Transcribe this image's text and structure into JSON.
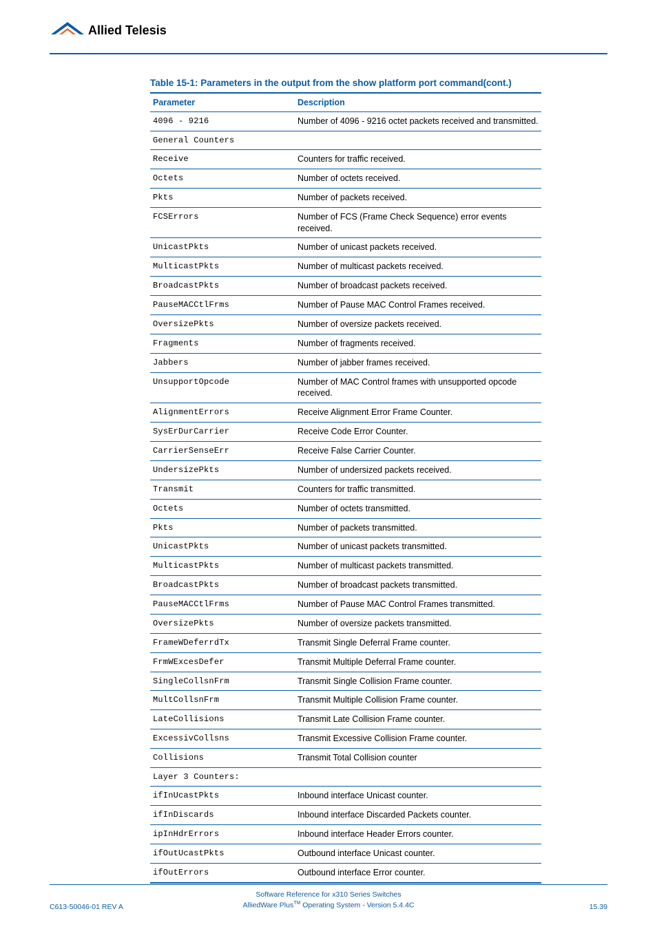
{
  "logo_text": "Allied Telesis",
  "table_caption": "Table 15-1: Parameters in the output from the show platform port command(cont.)",
  "headers": {
    "param": "Parameter",
    "desc": "Description"
  },
  "rows": [
    {
      "param": "4096 - 9216",
      "desc": "Number of 4096 - 9216 octet packets received and transmitted."
    },
    {
      "param": "General Counters",
      "desc": ""
    },
    {
      "param": "Receive",
      "desc": "Counters for traffic received."
    },
    {
      "param": "Octets",
      "desc": "Number of octets received."
    },
    {
      "param": "Pkts",
      "desc": "Number of packets received."
    },
    {
      "param": "FCSErrors",
      "desc": "Number of FCS (Frame Check Sequence) error events received."
    },
    {
      "param": "UnicastPkts",
      "desc": "Number of unicast packets received."
    },
    {
      "param": "MulticastPkts",
      "desc": "Number of multicast packets received."
    },
    {
      "param": "BroadcastPkts",
      "desc": "Number of broadcast packets received."
    },
    {
      "param": "PauseMACCtlFrms",
      "desc": "Number of Pause MAC Control Frames received."
    },
    {
      "param": "OversizePkts",
      "desc": "Number of oversize packets received."
    },
    {
      "param": "Fragments",
      "desc": "Number of fragments received."
    },
    {
      "param": "Jabbers",
      "desc": "Number of jabber frames received."
    },
    {
      "param": "UnsupportOpcode",
      "desc": "Number of MAC Control frames with unsupported opcode received."
    },
    {
      "param": "AlignmentErrors",
      "desc": "Receive Alignment Error Frame Counter."
    },
    {
      "param": "SysErDurCarrier",
      "desc": "Receive Code Error Counter."
    },
    {
      "param": "CarrierSenseErr",
      "desc": "Receive False Carrier Counter."
    },
    {
      "param": "UndersizePkts",
      "desc": "Number of undersized packets received."
    },
    {
      "param": "Transmit",
      "desc": "Counters for traffic transmitted."
    },
    {
      "param": "Octets",
      "desc": "Number of octets transmitted."
    },
    {
      "param": "Pkts",
      "desc": "Number of packets transmitted."
    },
    {
      "param": "UnicastPkts",
      "desc": "Number of unicast packets transmitted."
    },
    {
      "param": "MulticastPkts",
      "desc": "Number of multicast packets transmitted."
    },
    {
      "param": "BroadcastPkts",
      "desc": "Number of broadcast packets transmitted."
    },
    {
      "param": "PauseMACCtlFrms",
      "desc": "Number of Pause MAC Control Frames transmitted."
    },
    {
      "param": "OversizePkts",
      "desc": "Number of oversize packets transmitted."
    },
    {
      "param": "FrameWDeferrdTx",
      "desc": "Transmit Single Deferral Frame counter."
    },
    {
      "param": "FrmWExcesDefer",
      "desc": "Transmit Multiple Deferral Frame counter."
    },
    {
      "param": "SingleCollsnFrm",
      "desc": "Transmit Single Collision Frame counter."
    },
    {
      "param": "MultCollsnFrm",
      "desc": "Transmit Multiple Collision Frame counter."
    },
    {
      "param": "LateCollisions",
      "desc": "Transmit Late Collision Frame counter."
    },
    {
      "param": "ExcessivCollsns",
      "desc": "Transmit Excessive Collision Frame counter."
    },
    {
      "param": "Collisions",
      "desc": "Transmit Total Collision counter"
    },
    {
      "param": "Layer 3 Counters:",
      "desc": ""
    },
    {
      "param": "ifInUcastPkts",
      "desc": "Inbound interface Unicast counter."
    },
    {
      "param": "ifInDiscards",
      "desc": "Inbound interface Discarded Packets counter."
    },
    {
      "param": "ipInHdrErrors",
      "desc": "Inbound interface Header Errors counter."
    },
    {
      "param": "ifOutUcastPkts",
      "desc": "Outbound interface Unicast counter."
    },
    {
      "param": "ifOutErrors",
      "desc": "Outbound interface Error counter."
    }
  ],
  "footer": {
    "line1": "Software Reference for x310 Series Switches",
    "line2_pre": "AlliedWare Plus",
    "line2_post": " Operating System - Version 5.4.4C",
    "rev": "C613-50046-01 REV A",
    "page": "15.39"
  }
}
